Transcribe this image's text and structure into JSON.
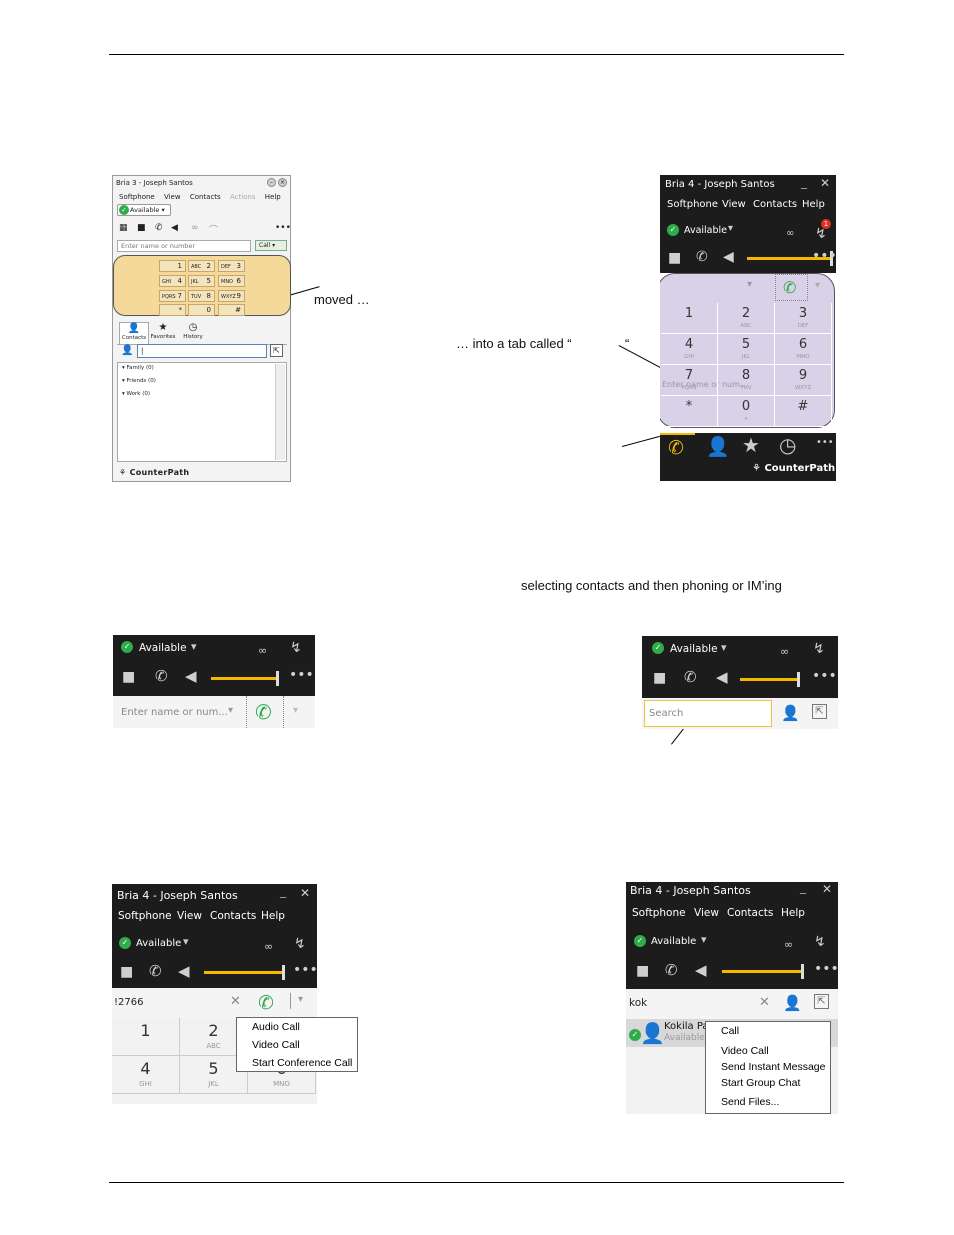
{
  "annotations": {
    "moved": "moved …",
    "into_tab": "… into a tab called “",
    "quote_close": "“",
    "selecting": "selecting contacts and then phoning or IM’ing"
  },
  "bria3": {
    "title": "Bria 3 - Joseph Santos",
    "menu": [
      "Softphone",
      "View",
      "Contacts",
      "Actions",
      "Help"
    ],
    "status": "Available",
    "entry_placeholder": "Enter name or number",
    "call_button": "Call",
    "keys": [
      {
        "n": "1",
        "l": ""
      },
      {
        "n": "2",
        "l": "ABC"
      },
      {
        "n": "3",
        "l": "DEF"
      },
      {
        "n": "4",
        "l": "GHI"
      },
      {
        "n": "5",
        "l": "JKL"
      },
      {
        "n": "6",
        "l": "MNO"
      },
      {
        "n": "7",
        "l": "PQRS"
      },
      {
        "n": "8",
        "l": "TUV"
      },
      {
        "n": "9",
        "l": "WXYZ"
      },
      {
        "n": "*",
        "l": ""
      },
      {
        "n": "0",
        "l": ""
      },
      {
        "n": "#",
        "l": ""
      }
    ],
    "tabs": [
      "Contacts",
      "Favorites",
      "History"
    ],
    "search_value": "|",
    "groups": [
      "Family (0)",
      "Friends (0)",
      "Work (0)"
    ],
    "logo": "CounterPath"
  },
  "bria4": {
    "title": "Bria 4 - Joseph Santos",
    "menu": [
      "Softphone",
      "View",
      "Contacts",
      "Help"
    ],
    "status": "Available",
    "badge": "1",
    "entry_placeholder": "Enter name or num...",
    "keys": [
      {
        "n": "1",
        "l": ""
      },
      {
        "n": "2",
        "l": "ABC"
      },
      {
        "n": "3",
        "l": "DEF"
      },
      {
        "n": "4",
        "l": "GHI"
      },
      {
        "n": "5",
        "l": "JKL"
      },
      {
        "n": "6",
        "l": "MNO"
      },
      {
        "n": "7",
        "l": "PQRS"
      },
      {
        "n": "8",
        "l": "TUV"
      },
      {
        "n": "9",
        "l": "WXYZ"
      },
      {
        "n": "*",
        "l": ""
      },
      {
        "n": "0",
        "l": "+"
      },
      {
        "n": "#",
        "l": ""
      }
    ],
    "logo": "CounterPath"
  },
  "panel_a": {
    "status": "Available",
    "entry_placeholder": "Enter name or num..."
  },
  "panel_b": {
    "status": "Available",
    "search_placeholder": "Search"
  },
  "panel_c": {
    "title": "Bria 4 - Joseph Santos",
    "menu": [
      "Softphone",
      "View",
      "Contacts",
      "Help"
    ],
    "status": "Available",
    "entry_value": "!2766",
    "menu_items": [
      "Audio Call",
      "Video Call",
      "Start Conference Call"
    ],
    "keys": [
      {
        "n": "1",
        "l": ""
      },
      {
        "n": "2",
        "l": "ABC"
      },
      {
        "n": "3",
        "l": ""
      },
      {
        "n": "4",
        "l": "GHI"
      },
      {
        "n": "5",
        "l": "JKL"
      },
      {
        "n": "6",
        "l": "MNO"
      }
    ]
  },
  "panel_d": {
    "title": "Bria 4 - Joseph Santos",
    "menu": [
      "Softphone",
      "View",
      "Contacts",
      "Help"
    ],
    "status": "Available",
    "search_value": "kok",
    "contact_name": "Kokila Pa",
    "contact_status": "Available",
    "menu_items": [
      "Call",
      "Video Call",
      "Send Instant Message",
      "Start Group Chat",
      "Send Files..."
    ]
  }
}
